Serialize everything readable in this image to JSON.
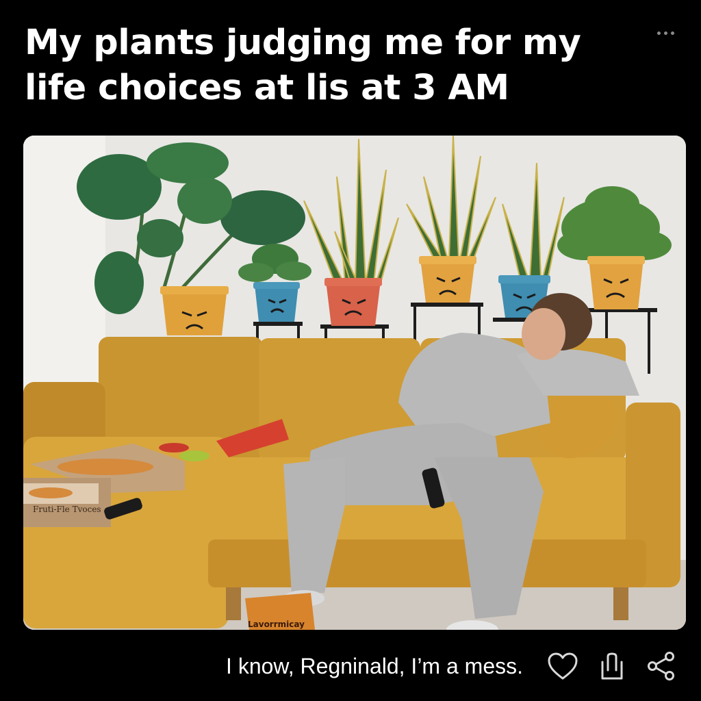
{
  "post": {
    "title": "My plants judging me for my life choices at lis at 3 AM",
    "caption": "I know, Regninald, I’m a mess."
  },
  "image": {
    "pizza_box_text": "Fruti-Fle Tvoces",
    "chip_bag_text": "Lavorrmicay"
  },
  "actions": {
    "more_icon": "more-horizontal-icon",
    "like_icon": "heart-icon",
    "save_icon": "upload-icon",
    "share_icon": "share-icon"
  },
  "colors": {
    "background": "#000000",
    "text": "#ffffff",
    "icon": "#d9d9d9",
    "sofa": "#d9a63c"
  }
}
